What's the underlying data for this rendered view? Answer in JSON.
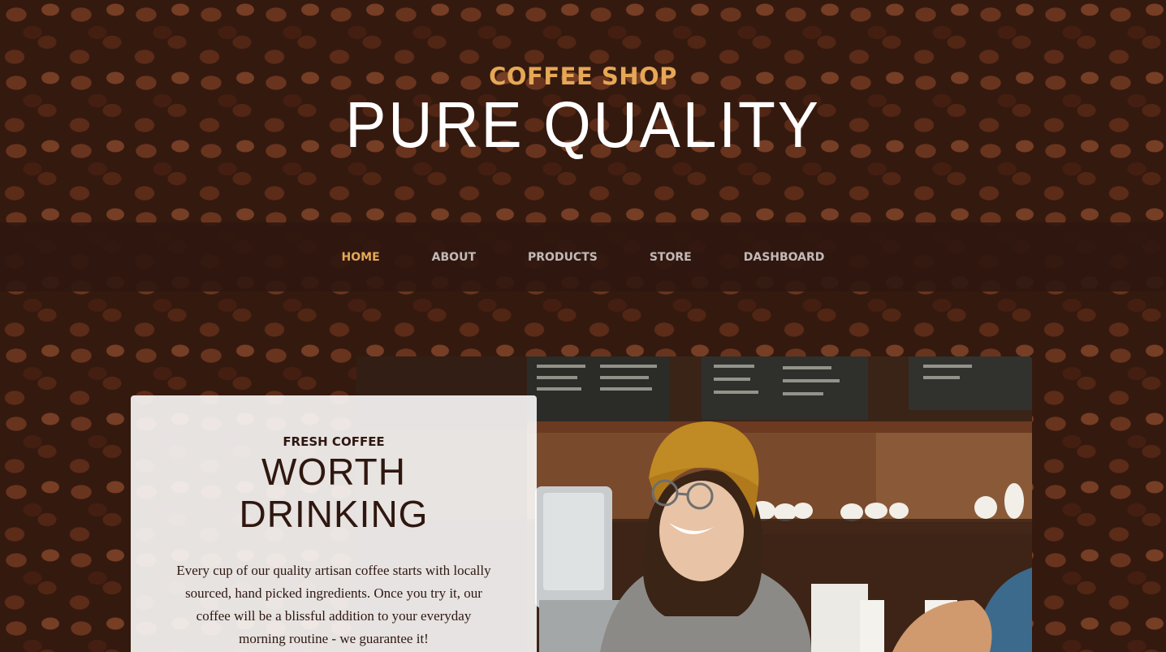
{
  "header": {
    "upper": "COFFEE SHOP",
    "lower": "PURE QUALITY"
  },
  "nav": {
    "items": [
      {
        "label": "HOME",
        "active": true
      },
      {
        "label": "ABOUT",
        "active": false
      },
      {
        "label": "PRODUCTS",
        "active": false
      },
      {
        "label": "STORE",
        "active": false
      },
      {
        "label": "DASHBOARD",
        "active": false
      }
    ]
  },
  "intro": {
    "upper": "FRESH COFFEE",
    "lower": "WORTH DRINKING",
    "body": "Every cup of our quality artisan coffee starts with locally sourced, hand picked ingredients. Once you try it, our coffee will be a blissful addition to your everyday morning routine - we guarantee it!",
    "image_icon": "barista-photo"
  },
  "colors": {
    "accent": "#e6a756",
    "primary_dark": "#2f170f",
    "nav_bg": "#2f170f",
    "text_light": "#ffffff"
  }
}
